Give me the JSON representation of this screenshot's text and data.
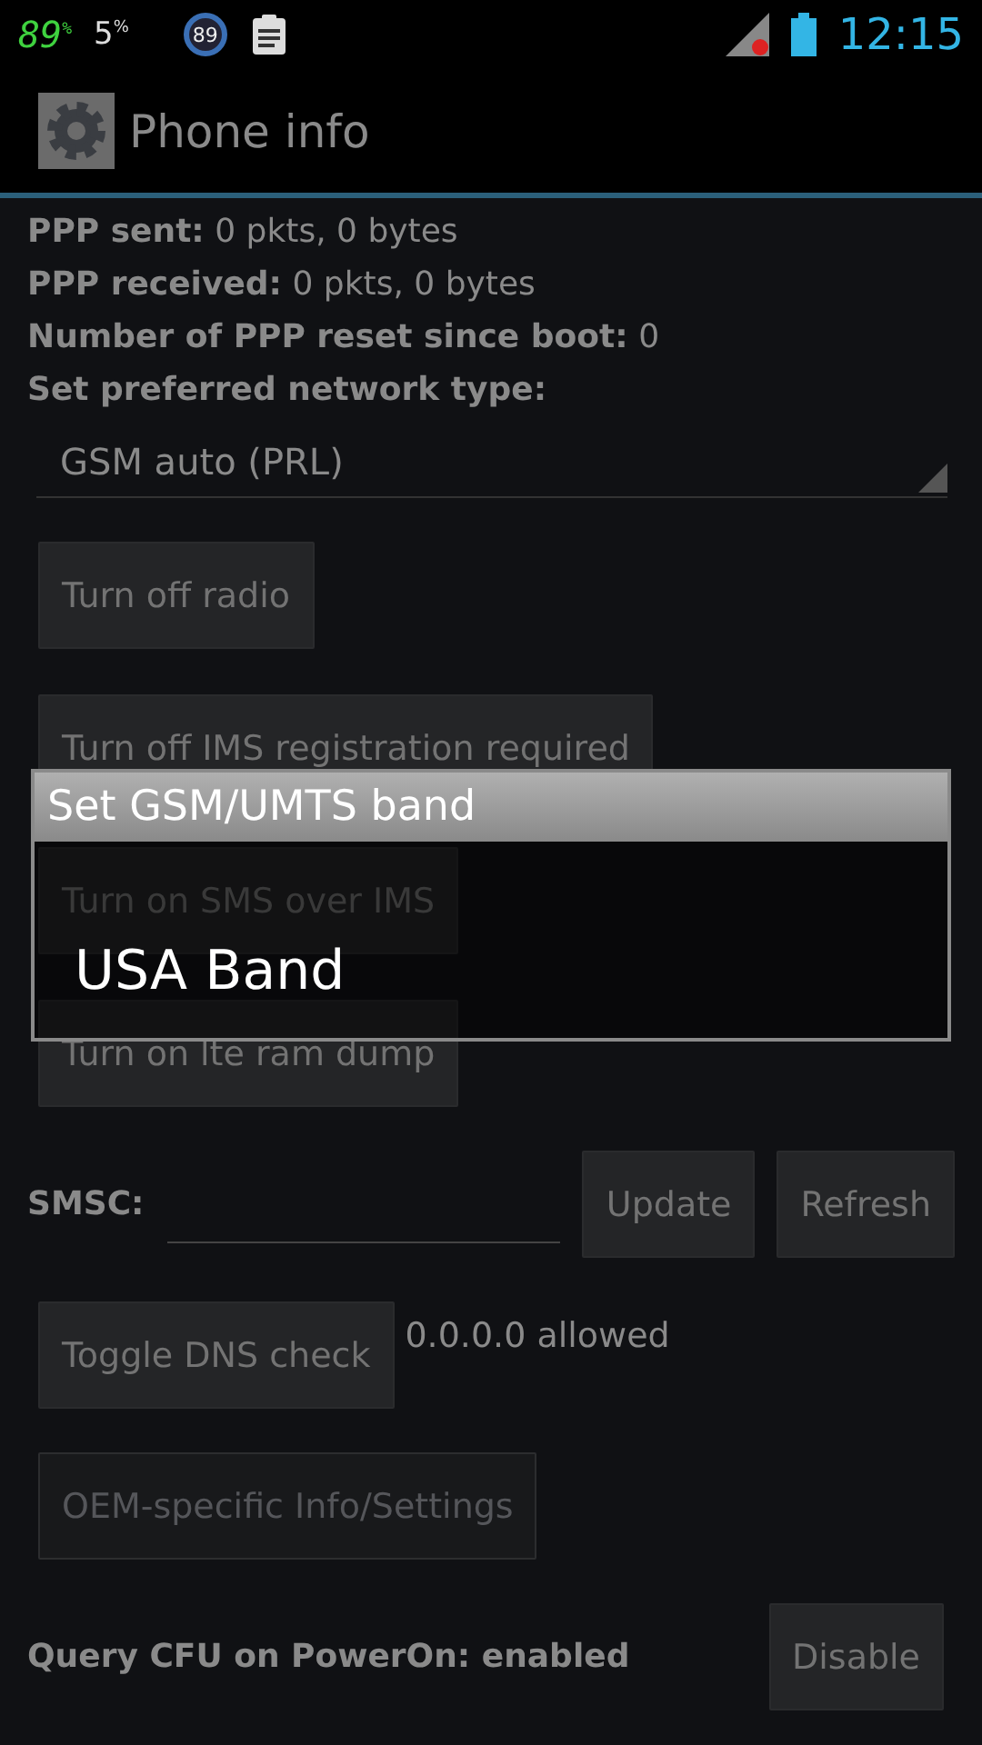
{
  "status_bar": {
    "temperature": "89",
    "temperature_unit": "%",
    "storage": "5",
    "storage_unit": "%",
    "badge": "89",
    "time": "12:15"
  },
  "action_bar": {
    "title": "Phone info"
  },
  "info_lines": [
    {
      "label": "PPP sent:",
      "value": "0 pkts, 0 bytes"
    },
    {
      "label": "PPP received:",
      "value": "0 pkts, 0 bytes"
    },
    {
      "label": "Number of PPP reset since boot:",
      "value": "0"
    },
    {
      "label": "Set preferred network type:"
    }
  ],
  "network_spinner": {
    "value": "GSM auto (PRL)"
  },
  "buttons": [
    {
      "label": "Turn off radio"
    },
    {
      "label": "Turn off IMS registration required"
    },
    {
      "label": "Turn on SMS over IMS"
    },
    {
      "label": "Turn on lte ram dump"
    }
  ],
  "smsc": {
    "label": "SMSC:",
    "buttons": [
      "Update",
      "Refresh"
    ]
  },
  "dns": {
    "button": "Toggle DNS check",
    "status": "0.0.0.0 allowed"
  },
  "oem_button": {
    "label": "OEM-specific Info/Settings",
    "disabled": true
  },
  "cfu": {
    "label": "Query CFU on PowerOn: enabled",
    "button": "Disable"
  },
  "dialog": {
    "title": "Set GSM/UMTS band",
    "items": [
      "USA Band"
    ]
  }
}
